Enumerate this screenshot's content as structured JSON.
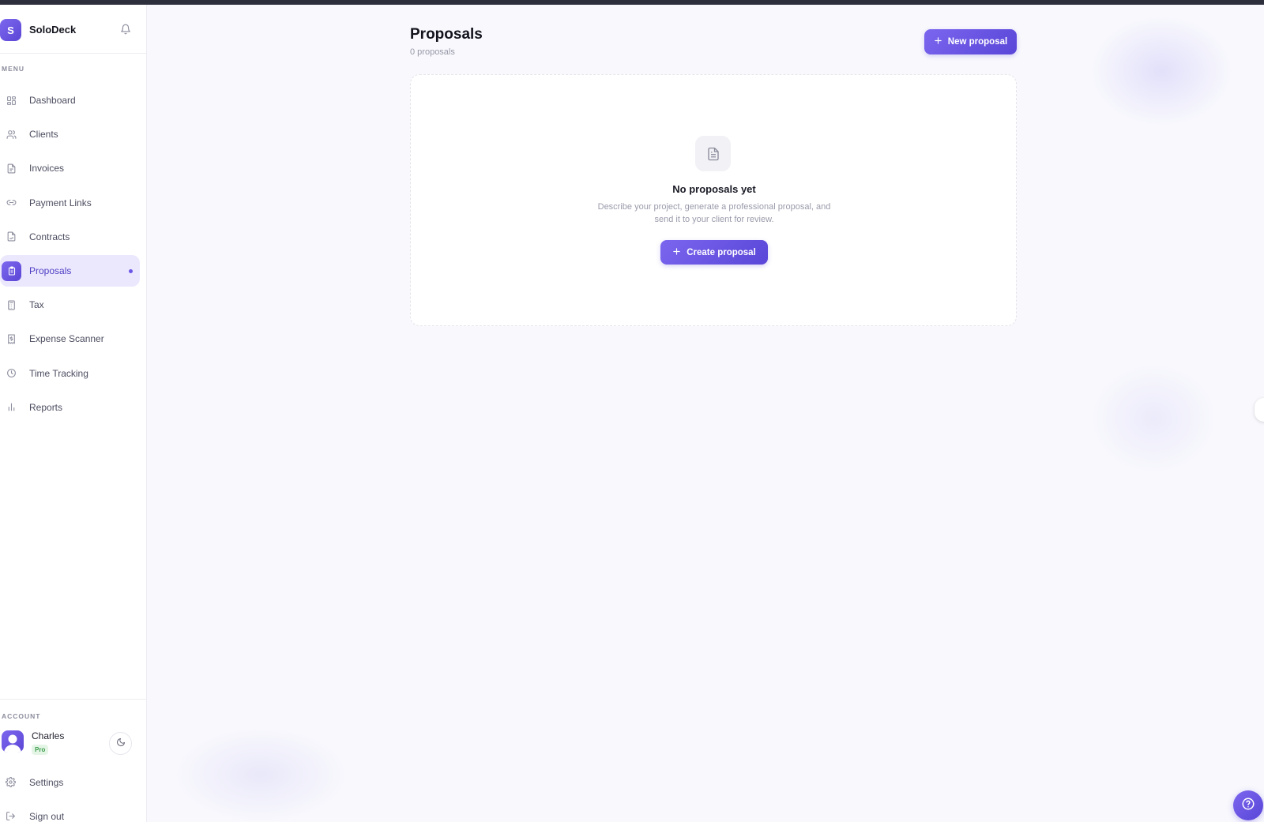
{
  "brand": {
    "logo_letter": "S",
    "name": "SoloDeck"
  },
  "sidebar": {
    "menu_label": "MENU",
    "items": [
      {
        "label": "Dashboard",
        "icon": "grid-icon"
      },
      {
        "label": "Clients",
        "icon": "users-icon"
      },
      {
        "label": "Invoices",
        "icon": "file-icon"
      },
      {
        "label": "Payment Links",
        "icon": "link-icon"
      },
      {
        "label": "Contracts",
        "icon": "file-signature-icon"
      },
      {
        "label": "Proposals",
        "icon": "clipboard-icon",
        "active": true
      },
      {
        "label": "Tax",
        "icon": "calculator-icon"
      },
      {
        "label": "Expense Scanner",
        "icon": "receipt-icon"
      },
      {
        "label": "Time Tracking",
        "icon": "clock-icon"
      },
      {
        "label": "Reports",
        "icon": "bar-chart-icon"
      }
    ],
    "account_label": "ACCOUNT",
    "user": {
      "name": "Charles",
      "plan": "Pro"
    },
    "settings_label": "Settings",
    "signout_label": "Sign out"
  },
  "main": {
    "title": "Proposals",
    "count": "0 proposals",
    "new_button_label": "New proposal",
    "empty": {
      "title": "No proposals yet",
      "description": "Describe your project, generate a professional proposal, and send it to your client for review.",
      "create_button_label": "Create proposal"
    }
  },
  "colors": {
    "accent": "#6a56e6",
    "accent_light": "#ebe8fd",
    "plan_badge": "#3f9d4f"
  }
}
